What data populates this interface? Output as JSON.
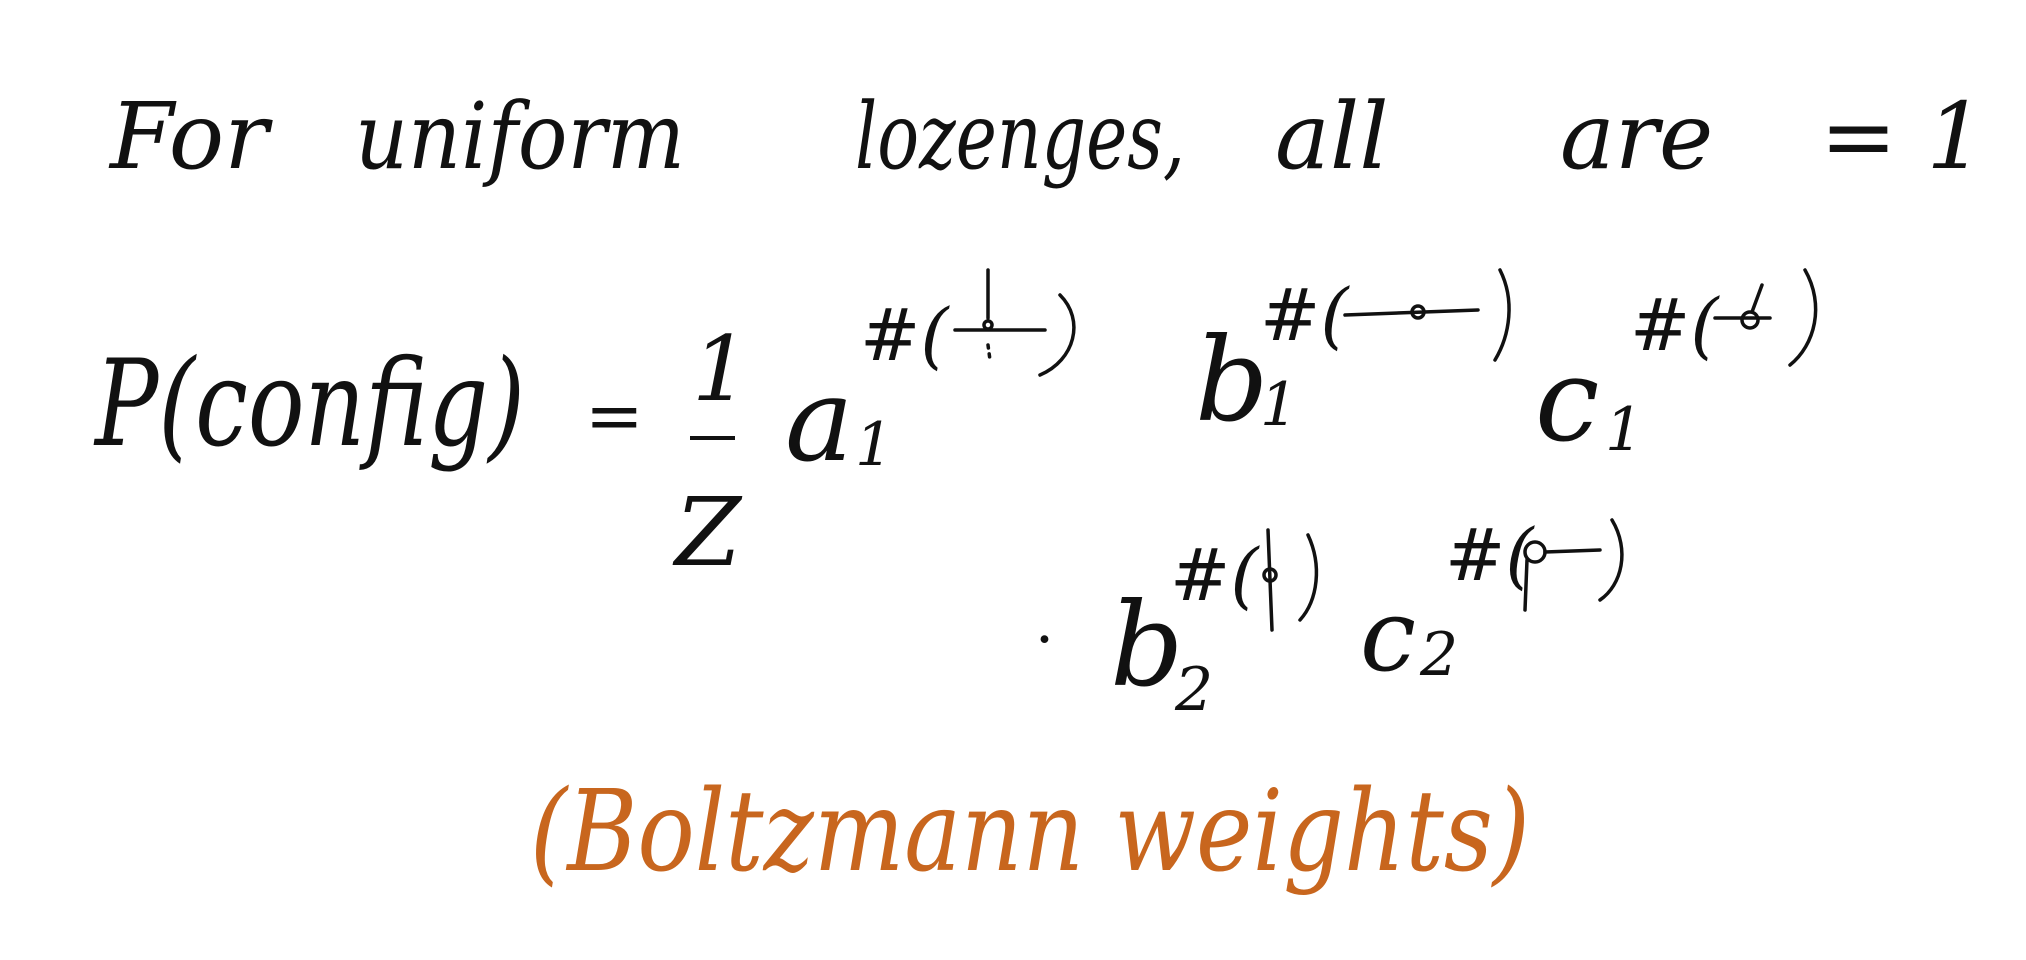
{
  "colors": {
    "background": "#ffffff",
    "ink": "#111111",
    "accent": "#c8661e"
  },
  "line1": {
    "w1": "For",
    "w2": "uniform",
    "w3": "lozenges,",
    "w4": "all",
    "w5": "are",
    "w6": "= 1"
  },
  "formula": {
    "lhs": "P(config)",
    "eq": "=",
    "frac_num": "1",
    "frac_den": "Z",
    "a1": "a",
    "a1_sub": "1",
    "a1_exp": "#(",
    "b1": "b",
    "b1_sub": "1",
    "b1_exp": "#(",
    "c1": "c",
    "c1_sub": "1",
    "c1_exp": "#(",
    "dot": "·",
    "b2": "b",
    "b2_sub": "2",
    "b2_exp": "#(",
    "c2": "c",
    "c2_sub": "2",
    "c2_exp": "#("
  },
  "note": "(Boltzmann weights)"
}
